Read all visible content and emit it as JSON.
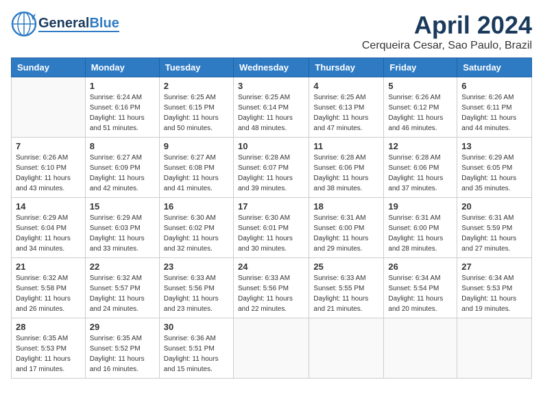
{
  "header": {
    "logo_line1": "General",
    "logo_line2": "Blue",
    "month": "April 2024",
    "location": "Cerqueira Cesar, Sao Paulo, Brazil"
  },
  "days_of_week": [
    "Sunday",
    "Monday",
    "Tuesday",
    "Wednesday",
    "Thursday",
    "Friday",
    "Saturday"
  ],
  "weeks": [
    [
      {
        "num": "",
        "info": ""
      },
      {
        "num": "1",
        "info": "Sunrise: 6:24 AM\nSunset: 6:16 PM\nDaylight: 11 hours\nand 51 minutes."
      },
      {
        "num": "2",
        "info": "Sunrise: 6:25 AM\nSunset: 6:15 PM\nDaylight: 11 hours\nand 50 minutes."
      },
      {
        "num": "3",
        "info": "Sunrise: 6:25 AM\nSunset: 6:14 PM\nDaylight: 11 hours\nand 48 minutes."
      },
      {
        "num": "4",
        "info": "Sunrise: 6:25 AM\nSunset: 6:13 PM\nDaylight: 11 hours\nand 47 minutes."
      },
      {
        "num": "5",
        "info": "Sunrise: 6:26 AM\nSunset: 6:12 PM\nDaylight: 11 hours\nand 46 minutes."
      },
      {
        "num": "6",
        "info": "Sunrise: 6:26 AM\nSunset: 6:11 PM\nDaylight: 11 hours\nand 44 minutes."
      }
    ],
    [
      {
        "num": "7",
        "info": "Sunrise: 6:26 AM\nSunset: 6:10 PM\nDaylight: 11 hours\nand 43 minutes."
      },
      {
        "num": "8",
        "info": "Sunrise: 6:27 AM\nSunset: 6:09 PM\nDaylight: 11 hours\nand 42 minutes."
      },
      {
        "num": "9",
        "info": "Sunrise: 6:27 AM\nSunset: 6:08 PM\nDaylight: 11 hours\nand 41 minutes."
      },
      {
        "num": "10",
        "info": "Sunrise: 6:28 AM\nSunset: 6:07 PM\nDaylight: 11 hours\nand 39 minutes."
      },
      {
        "num": "11",
        "info": "Sunrise: 6:28 AM\nSunset: 6:06 PM\nDaylight: 11 hours\nand 38 minutes."
      },
      {
        "num": "12",
        "info": "Sunrise: 6:28 AM\nSunset: 6:06 PM\nDaylight: 11 hours\nand 37 minutes."
      },
      {
        "num": "13",
        "info": "Sunrise: 6:29 AM\nSunset: 6:05 PM\nDaylight: 11 hours\nand 35 minutes."
      }
    ],
    [
      {
        "num": "14",
        "info": "Sunrise: 6:29 AM\nSunset: 6:04 PM\nDaylight: 11 hours\nand 34 minutes."
      },
      {
        "num": "15",
        "info": "Sunrise: 6:29 AM\nSunset: 6:03 PM\nDaylight: 11 hours\nand 33 minutes."
      },
      {
        "num": "16",
        "info": "Sunrise: 6:30 AM\nSunset: 6:02 PM\nDaylight: 11 hours\nand 32 minutes."
      },
      {
        "num": "17",
        "info": "Sunrise: 6:30 AM\nSunset: 6:01 PM\nDaylight: 11 hours\nand 30 minutes."
      },
      {
        "num": "18",
        "info": "Sunrise: 6:31 AM\nSunset: 6:00 PM\nDaylight: 11 hours\nand 29 minutes."
      },
      {
        "num": "19",
        "info": "Sunrise: 6:31 AM\nSunset: 6:00 PM\nDaylight: 11 hours\nand 28 minutes."
      },
      {
        "num": "20",
        "info": "Sunrise: 6:31 AM\nSunset: 5:59 PM\nDaylight: 11 hours\nand 27 minutes."
      }
    ],
    [
      {
        "num": "21",
        "info": "Sunrise: 6:32 AM\nSunset: 5:58 PM\nDaylight: 11 hours\nand 26 minutes."
      },
      {
        "num": "22",
        "info": "Sunrise: 6:32 AM\nSunset: 5:57 PM\nDaylight: 11 hours\nand 24 minutes."
      },
      {
        "num": "23",
        "info": "Sunrise: 6:33 AM\nSunset: 5:56 PM\nDaylight: 11 hours\nand 23 minutes."
      },
      {
        "num": "24",
        "info": "Sunrise: 6:33 AM\nSunset: 5:56 PM\nDaylight: 11 hours\nand 22 minutes."
      },
      {
        "num": "25",
        "info": "Sunrise: 6:33 AM\nSunset: 5:55 PM\nDaylight: 11 hours\nand 21 minutes."
      },
      {
        "num": "26",
        "info": "Sunrise: 6:34 AM\nSunset: 5:54 PM\nDaylight: 11 hours\nand 20 minutes."
      },
      {
        "num": "27",
        "info": "Sunrise: 6:34 AM\nSunset: 5:53 PM\nDaylight: 11 hours\nand 19 minutes."
      }
    ],
    [
      {
        "num": "28",
        "info": "Sunrise: 6:35 AM\nSunset: 5:53 PM\nDaylight: 11 hours\nand 17 minutes."
      },
      {
        "num": "29",
        "info": "Sunrise: 6:35 AM\nSunset: 5:52 PM\nDaylight: 11 hours\nand 16 minutes."
      },
      {
        "num": "30",
        "info": "Sunrise: 6:36 AM\nSunset: 5:51 PM\nDaylight: 11 hours\nand 15 minutes."
      },
      {
        "num": "",
        "info": ""
      },
      {
        "num": "",
        "info": ""
      },
      {
        "num": "",
        "info": ""
      },
      {
        "num": "",
        "info": ""
      }
    ]
  ]
}
